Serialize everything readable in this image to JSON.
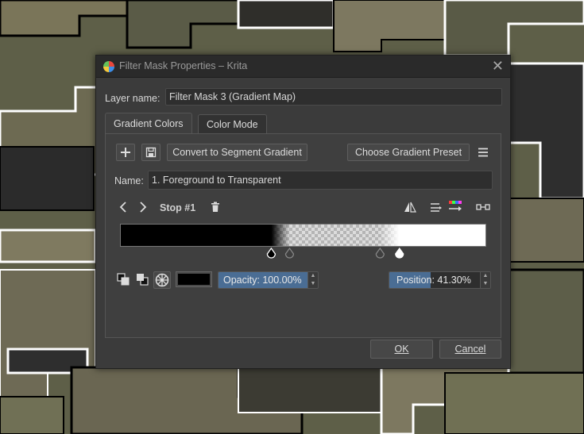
{
  "window": {
    "title": "Filter Mask Properties – Krita",
    "close_glyph": "✕"
  },
  "layer_name": {
    "label": "Layer name:",
    "value": "Filter Mask 3 (Gradient Map)"
  },
  "tabs": [
    {
      "label": "Gradient Colors",
      "active": true
    },
    {
      "label": "Color Mode",
      "active": false
    }
  ],
  "toolbar": {
    "add_icon": "plus-icon",
    "save_icon": "save-icon",
    "convert_label": "Convert to Segment Gradient",
    "preset_label": "Choose Gradient Preset",
    "menu_icon": "hamburger-menu-icon"
  },
  "name_field": {
    "label": "Name:",
    "value": "1. Foreground to Transparent"
  },
  "stop_nav": {
    "prev_icon": "chevron-left-icon",
    "next_icon": "chevron-right-icon",
    "label": "Stop #1",
    "delete_icon": "trash-icon"
  },
  "right_tools": {
    "flip_icon": "flip-gradient-icon",
    "distribute_icon": "distribute-stops-icon",
    "color_sort_icon": "color-sort-icon",
    "fit_icon": "fit-stops-icon"
  },
  "gradient": {
    "stops": [
      {
        "position": 0.413,
        "color": "#000000",
        "opacity": 1.0,
        "selected": true
      },
      {
        "position": 0.463,
        "color": "#000000",
        "opacity": 0.0,
        "selected": false
      },
      {
        "position": 0.71,
        "color": "#ffffff",
        "opacity": 0.0,
        "selected": false
      },
      {
        "position": 0.763,
        "color": "#ffffff",
        "opacity": 1.0,
        "selected": false
      }
    ]
  },
  "stop_props": {
    "fg_icon": "foreground-color-icon",
    "bg_icon": "background-color-icon",
    "custom_icon": "custom-color-wheel-icon",
    "color": "#000000",
    "opacity_label": "Opacity: 100.00%",
    "opacity_value": 1.0,
    "position_label": "Position: 41.30%",
    "position_value": 0.413
  },
  "buttons": {
    "ok": "OK",
    "cancel": "Cancel"
  }
}
